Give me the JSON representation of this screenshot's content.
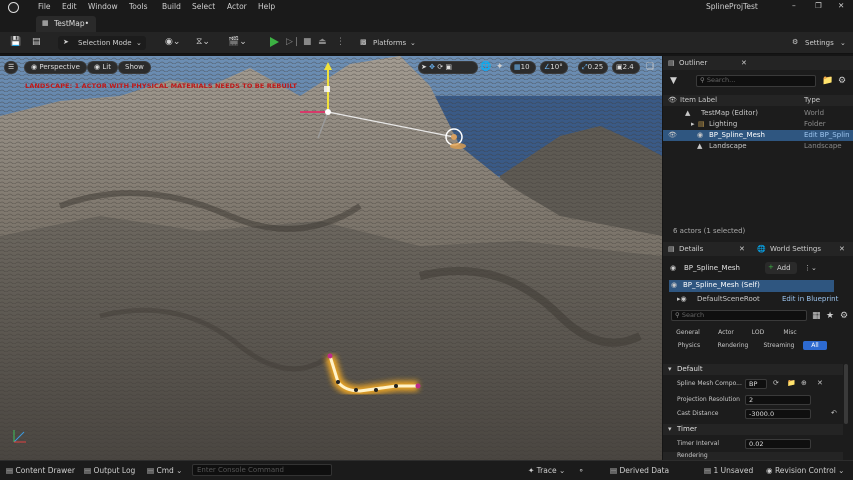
{
  "window": {
    "title": "SplineProjTest",
    "tab_label": "TestMap•",
    "menu": [
      "File",
      "Edit",
      "Window",
      "Tools",
      "Build",
      "Select",
      "Actor",
      "Help"
    ]
  },
  "toolbar": {
    "mode_label": "Selection Mode",
    "platforms_label": "Platforms",
    "settings_label": "Settings"
  },
  "viewport": {
    "perspective_label": "Perspective",
    "lit_label": "Lit",
    "show_label": "Show",
    "grid_snap": "10",
    "rot_snap": "10°",
    "scale_snap": "0.25",
    "camera_speed": "2.4",
    "warning_text": "LANDSCAPE: 1 ACTOR WITH PHYSICAL MATERIALS NEEDS TO BE REBUILT"
  },
  "outliner": {
    "title": "Outliner",
    "search_placeholder": "Search...",
    "col_label": "Item Label",
    "col_type": "Type",
    "rows": [
      {
        "label": "TestMap (Editor)",
        "type": "World"
      },
      {
        "label": "Lighting",
        "type": "Folder"
      },
      {
        "label": "BP_Spline_Mesh",
        "type": "Edit BP_Splin"
      },
      {
        "label": "Landscape",
        "type": "Landscape"
      }
    ],
    "status": "6 actors (1 selected)"
  },
  "details": {
    "title": "Details",
    "world_settings_title": "World Settings",
    "actor_name": "BP_Spline_Mesh",
    "add_label": "Add",
    "self_label": "BP_Spline_Mesh (Self)",
    "root_label": "DefaultSceneRoot",
    "edit_bp_label": "Edit in Blueprint",
    "search_placeholder": "Search",
    "filters_row1": [
      "General",
      "Actor",
      "LOD",
      "Misc"
    ],
    "filters_row2": [
      "Physics",
      "Rendering",
      "Streaming",
      "All"
    ],
    "section_default": "Default",
    "prop_spline_comp": "Spline Mesh Compo...",
    "prop_spline_value": "BP",
    "prop_proj_res": "Projection Resolution",
    "prop_proj_res_value": "2",
    "prop_cast_dist": "Cast Distance",
    "prop_cast_dist_value": "-3000.0",
    "section_timer": "Timer",
    "prop_timer_interval": "Timer Interval",
    "prop_timer_interval_value": "0.02",
    "section_rendering": "Rendering"
  },
  "statusbar": {
    "content_drawer": "Content Drawer",
    "output_log": "Output Log",
    "cmd": "Cmd",
    "console_placeholder": "Enter Console Command",
    "trace": "Trace",
    "derived_data": "Derived Data",
    "unsaved": "1 Unsaved",
    "revision_control": "Revision Control"
  },
  "colors": {
    "accent_blue": "#2f5680",
    "warning_red": "#c01818",
    "spline_glow": "#ffb020",
    "play_green": "#3cb043"
  }
}
